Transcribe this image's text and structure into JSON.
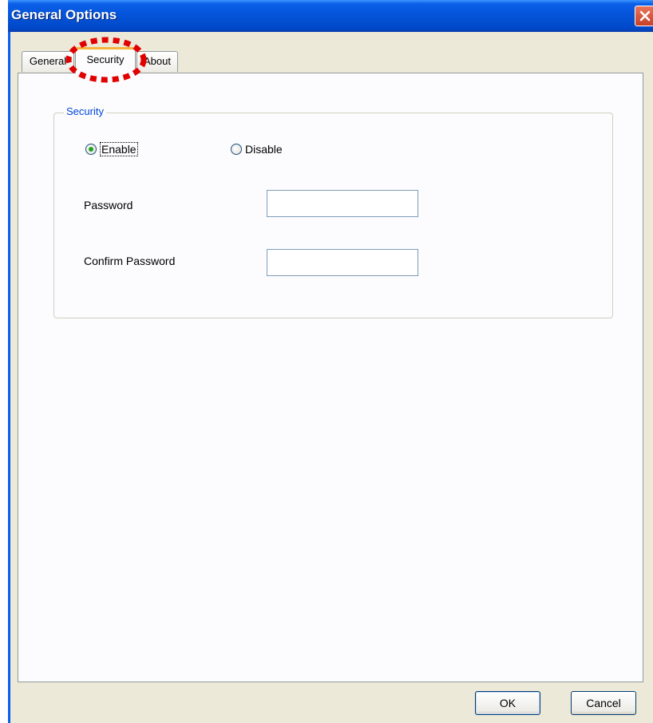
{
  "window": {
    "title": "General Options",
    "close_icon": "close-icon"
  },
  "tabs": [
    {
      "label": "General",
      "selected": false
    },
    {
      "label": "Security",
      "selected": true
    },
    {
      "label": "About",
      "selected": false
    }
  ],
  "security": {
    "group_label": "Security",
    "enable_label": "Enable",
    "disable_label": "Disable",
    "selected_option": "Enable",
    "password_label": "Password",
    "password_value": "",
    "confirm_label": "Confirm Password",
    "confirm_value": ""
  },
  "buttons": {
    "ok_label": "OK",
    "cancel_label": "Cancel"
  },
  "colors": {
    "titlebar": "#0553d8",
    "group_label": "#0046d5",
    "highlight_circle": "#e00000",
    "radio_dot": "#21a121"
  }
}
